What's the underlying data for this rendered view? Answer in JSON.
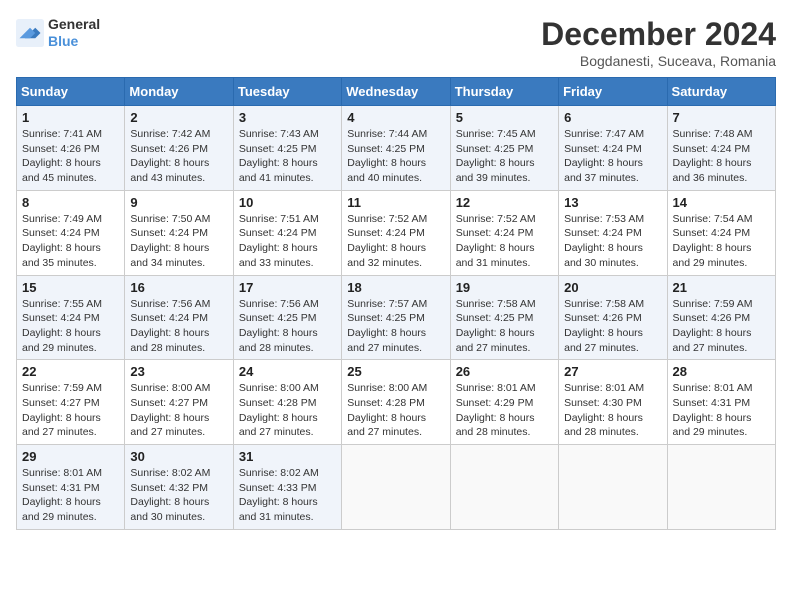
{
  "logo": {
    "line1": "General",
    "line2": "Blue"
  },
  "title": "December 2024",
  "subtitle": "Bogdanesti, Suceava, Romania",
  "days_header": [
    "Sunday",
    "Monday",
    "Tuesday",
    "Wednesday",
    "Thursday",
    "Friday",
    "Saturday"
  ],
  "weeks": [
    [
      {
        "day": "1",
        "sunrise": "7:41 AM",
        "sunset": "4:26 PM",
        "daylight": "8 hours and 45 minutes."
      },
      {
        "day": "2",
        "sunrise": "7:42 AM",
        "sunset": "4:26 PM",
        "daylight": "8 hours and 43 minutes."
      },
      {
        "day": "3",
        "sunrise": "7:43 AM",
        "sunset": "4:25 PM",
        "daylight": "8 hours and 41 minutes."
      },
      {
        "day": "4",
        "sunrise": "7:44 AM",
        "sunset": "4:25 PM",
        "daylight": "8 hours and 40 minutes."
      },
      {
        "day": "5",
        "sunrise": "7:45 AM",
        "sunset": "4:25 PM",
        "daylight": "8 hours and 39 minutes."
      },
      {
        "day": "6",
        "sunrise": "7:47 AM",
        "sunset": "4:24 PM",
        "daylight": "8 hours and 37 minutes."
      },
      {
        "day": "7",
        "sunrise": "7:48 AM",
        "sunset": "4:24 PM",
        "daylight": "8 hours and 36 minutes."
      }
    ],
    [
      {
        "day": "8",
        "sunrise": "7:49 AM",
        "sunset": "4:24 PM",
        "daylight": "8 hours and 35 minutes."
      },
      {
        "day": "9",
        "sunrise": "7:50 AM",
        "sunset": "4:24 PM",
        "daylight": "8 hours and 34 minutes."
      },
      {
        "day": "10",
        "sunrise": "7:51 AM",
        "sunset": "4:24 PM",
        "daylight": "8 hours and 33 minutes."
      },
      {
        "day": "11",
        "sunrise": "7:52 AM",
        "sunset": "4:24 PM",
        "daylight": "8 hours and 32 minutes."
      },
      {
        "day": "12",
        "sunrise": "7:52 AM",
        "sunset": "4:24 PM",
        "daylight": "8 hours and 31 minutes."
      },
      {
        "day": "13",
        "sunrise": "7:53 AM",
        "sunset": "4:24 PM",
        "daylight": "8 hours and 30 minutes."
      },
      {
        "day": "14",
        "sunrise": "7:54 AM",
        "sunset": "4:24 PM",
        "daylight": "8 hours and 29 minutes."
      }
    ],
    [
      {
        "day": "15",
        "sunrise": "7:55 AM",
        "sunset": "4:24 PM",
        "daylight": "8 hours and 29 minutes."
      },
      {
        "day": "16",
        "sunrise": "7:56 AM",
        "sunset": "4:24 PM",
        "daylight": "8 hours and 28 minutes."
      },
      {
        "day": "17",
        "sunrise": "7:56 AM",
        "sunset": "4:25 PM",
        "daylight": "8 hours and 28 minutes."
      },
      {
        "day": "18",
        "sunrise": "7:57 AM",
        "sunset": "4:25 PM",
        "daylight": "8 hours and 27 minutes."
      },
      {
        "day": "19",
        "sunrise": "7:58 AM",
        "sunset": "4:25 PM",
        "daylight": "8 hours and 27 minutes."
      },
      {
        "day": "20",
        "sunrise": "7:58 AM",
        "sunset": "4:26 PM",
        "daylight": "8 hours and 27 minutes."
      },
      {
        "day": "21",
        "sunrise": "7:59 AM",
        "sunset": "4:26 PM",
        "daylight": "8 hours and 27 minutes."
      }
    ],
    [
      {
        "day": "22",
        "sunrise": "7:59 AM",
        "sunset": "4:27 PM",
        "daylight": "8 hours and 27 minutes."
      },
      {
        "day": "23",
        "sunrise": "8:00 AM",
        "sunset": "4:27 PM",
        "daylight": "8 hours and 27 minutes."
      },
      {
        "day": "24",
        "sunrise": "8:00 AM",
        "sunset": "4:28 PM",
        "daylight": "8 hours and 27 minutes."
      },
      {
        "day": "25",
        "sunrise": "8:00 AM",
        "sunset": "4:28 PM",
        "daylight": "8 hours and 27 minutes."
      },
      {
        "day": "26",
        "sunrise": "8:01 AM",
        "sunset": "4:29 PM",
        "daylight": "8 hours and 28 minutes."
      },
      {
        "day": "27",
        "sunrise": "8:01 AM",
        "sunset": "4:30 PM",
        "daylight": "8 hours and 28 minutes."
      },
      {
        "day": "28",
        "sunrise": "8:01 AM",
        "sunset": "4:31 PM",
        "daylight": "8 hours and 29 minutes."
      }
    ],
    [
      {
        "day": "29",
        "sunrise": "8:01 AM",
        "sunset": "4:31 PM",
        "daylight": "8 hours and 29 minutes."
      },
      {
        "day": "30",
        "sunrise": "8:02 AM",
        "sunset": "4:32 PM",
        "daylight": "8 hours and 30 minutes."
      },
      {
        "day": "31",
        "sunrise": "8:02 AM",
        "sunset": "4:33 PM",
        "daylight": "8 hours and 31 minutes."
      },
      null,
      null,
      null,
      null
    ]
  ]
}
